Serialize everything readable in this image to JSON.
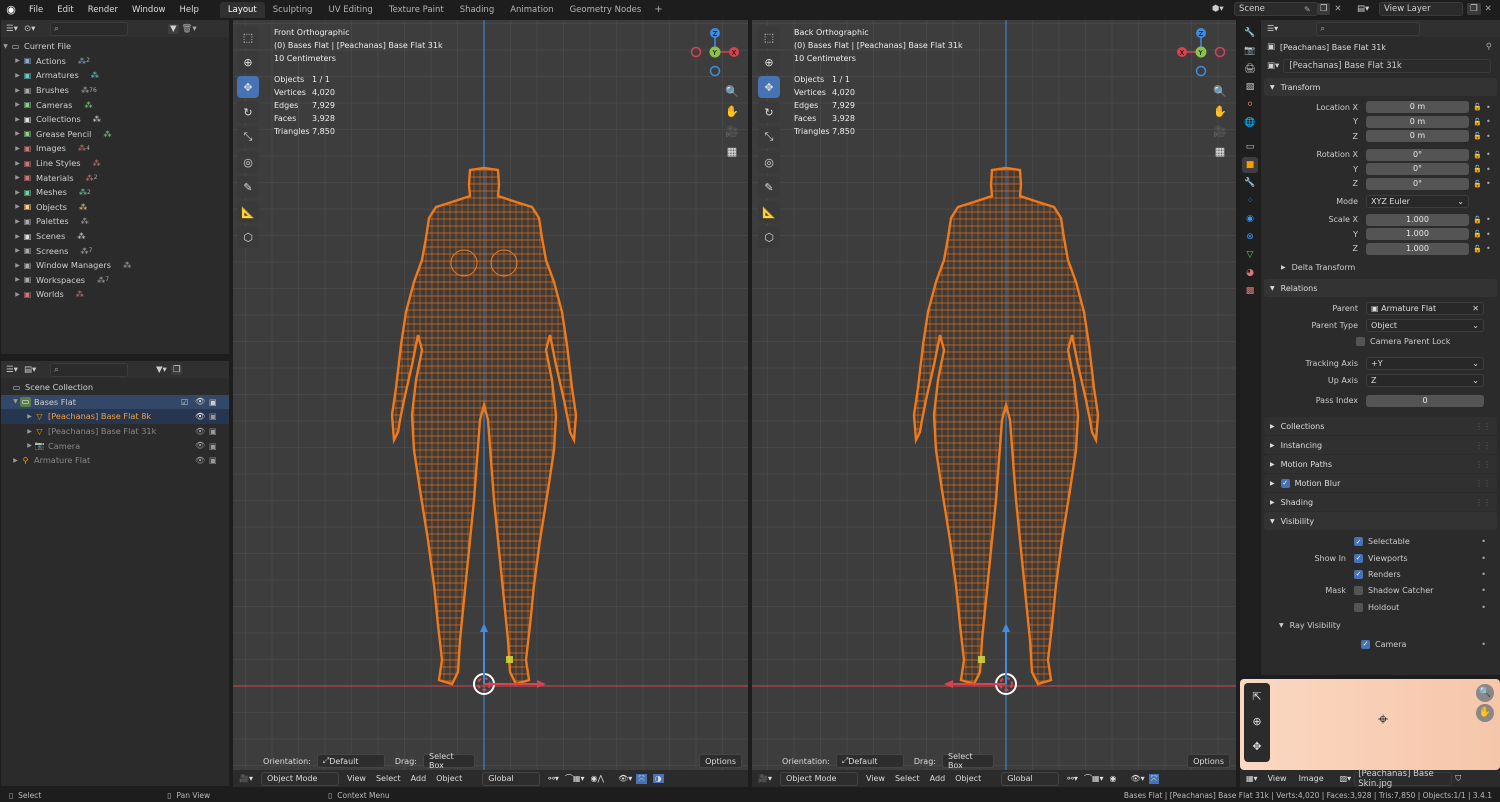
{
  "menus": [
    "File",
    "Edit",
    "Render",
    "Window",
    "Help"
  ],
  "workspaces": [
    "Layout",
    "Sculpting",
    "UV Editing",
    "Texture Paint",
    "Shading",
    "Animation",
    "Geometry Nodes"
  ],
  "scene_name": "Scene",
  "view_layer": "View Layer",
  "outliner_top": {
    "root": "Current File",
    "items": [
      {
        "label": "Actions",
        "badge": "2",
        "color": "#8ac"
      },
      {
        "label": "Armatures",
        "badge": "",
        "color": "#6cc"
      },
      {
        "label": "Brushes",
        "badge": "76",
        "color": "#aaa"
      },
      {
        "label": "Cameras",
        "badge": "",
        "color": "#8c8"
      },
      {
        "label": "Collections",
        "badge": "",
        "color": "#ddd"
      },
      {
        "label": "Grease Pencil",
        "badge": "",
        "color": "#8c8"
      },
      {
        "label": "Images",
        "badge": "4",
        "color": "#c77"
      },
      {
        "label": "Line Styles",
        "badge": "",
        "color": "#c77"
      },
      {
        "label": "Materials",
        "badge": "2",
        "color": "#c77"
      },
      {
        "label": "Meshes",
        "badge": "2",
        "color": "#7ca"
      },
      {
        "label": "Objects",
        "badge": "",
        "color": "#fc8"
      },
      {
        "label": "Palettes",
        "badge": "",
        "color": "#aaa"
      },
      {
        "label": "Scenes",
        "badge": "",
        "color": "#ddd"
      },
      {
        "label": "Screens",
        "badge": "7",
        "color": "#aaa"
      },
      {
        "label": "Window Managers",
        "badge": "",
        "color": "#aaa"
      },
      {
        "label": "Workspaces",
        "badge": "7",
        "color": "#aaa"
      },
      {
        "label": "Worlds",
        "badge": "",
        "color": "#c77"
      }
    ]
  },
  "outliner_bottom": {
    "scene_collection": "Scene Collection",
    "collection": "Bases Flat",
    "rows": [
      {
        "label": "[Peachanas] Base Flat 8k",
        "active": true
      },
      {
        "label": "[Peachanas] Base Flat 31k",
        "active": false
      },
      {
        "label": "Camera",
        "active": false
      },
      {
        "label": "Armature Flat",
        "active": false
      }
    ]
  },
  "viewport_left": {
    "title": "Front Orthographic",
    "subtitle": "(0) Bases Flat | [Peachanas] Base Flat 31k",
    "scale": "10 Centimeters",
    "stats": [
      [
        "Objects",
        "1 / 1"
      ],
      [
        "Vertices",
        "4,020"
      ],
      [
        "Edges",
        "7,929"
      ],
      [
        "Faces",
        "3,928"
      ],
      [
        "Triangles",
        "7,850"
      ]
    ]
  },
  "viewport_right": {
    "title": "Back Orthographic",
    "subtitle": "(0) Bases Flat | [Peachanas] Base Flat 31k",
    "scale": "10 Centimeters",
    "stats": [
      [
        "Objects",
        "1 / 1"
      ],
      [
        "Vertices",
        "4,020"
      ],
      [
        "Edges",
        "7,929"
      ],
      [
        "Faces",
        "3,928"
      ],
      [
        "Triangles",
        "7,850"
      ]
    ]
  },
  "viewport_bar": {
    "orientation_label": "Orientation:",
    "orientation_value": "Default",
    "drag_label": "Drag:",
    "drag_value": "Select Box",
    "options": "Options",
    "mode": "Object Mode",
    "menus": [
      "View",
      "Select",
      "Add",
      "Object"
    ],
    "transform": "Global"
  },
  "properties": {
    "search_placeholder": "",
    "object_name": "[Peachanas] Base Flat 31k",
    "object_field": "[Peachanas] Base Flat 31k",
    "transform_header": "Transform",
    "location": [
      [
        "Location X",
        "0 m"
      ],
      [
        "Y",
        "0 m"
      ],
      [
        "Z",
        "0 m"
      ]
    ],
    "rotation": [
      [
        "Rotation X",
        "0°"
      ],
      [
        "Y",
        "0°"
      ],
      [
        "Z",
        "0°"
      ]
    ],
    "mode_label": "Mode",
    "mode_value": "XYZ Euler",
    "scale": [
      [
        "Scale X",
        "1.000"
      ],
      [
        "Y",
        "1.000"
      ],
      [
        "Z",
        "1.000"
      ]
    ],
    "delta": "Delta Transform",
    "relations_header": "Relations",
    "parent_label": "Parent",
    "parent_value": "Armature Flat",
    "parent_type_label": "Parent Type",
    "parent_type_value": "Object",
    "camera_parent_lock": "Camera Parent Lock",
    "tracking_axis_label": "Tracking Axis",
    "tracking_axis_value": "+Y",
    "up_axis_label": "Up Axis",
    "up_axis_value": "Z",
    "pass_index_label": "Pass Index",
    "pass_index_value": "0",
    "collapsed": [
      "Collections",
      "Instancing",
      "Motion Paths",
      "Motion Blur",
      "Shading"
    ],
    "visibility_header": "Visibility",
    "selectable": "Selectable",
    "show_in": "Show In",
    "viewports": "Viewports",
    "renders": "Renders",
    "mask": "Mask",
    "shadow_catcher": "Shadow Catcher",
    "holdout": "Holdout",
    "ray_visibility": "Ray Visibility",
    "camera": "Camera"
  },
  "image_editor": {
    "menus": [
      "View",
      "Image"
    ],
    "image_name": "[Peachanas] Base Skin.jpg"
  },
  "status_bar": {
    "select": "Select",
    "pan": "Pan View",
    "context": "Context Menu",
    "info": "Bases Flat | [Peachanas] Base Flat 31k | Verts:4,020 | Faces:3,928 | Tris:7,850 | Objects:1/1 | 3.4.1"
  },
  "colors": {
    "accent": "#4772b3",
    "mesh": "#f07a1a",
    "axis_x": "#d9424f",
    "axis_y": "#8bc34a",
    "axis_z": "#3e8de0"
  }
}
